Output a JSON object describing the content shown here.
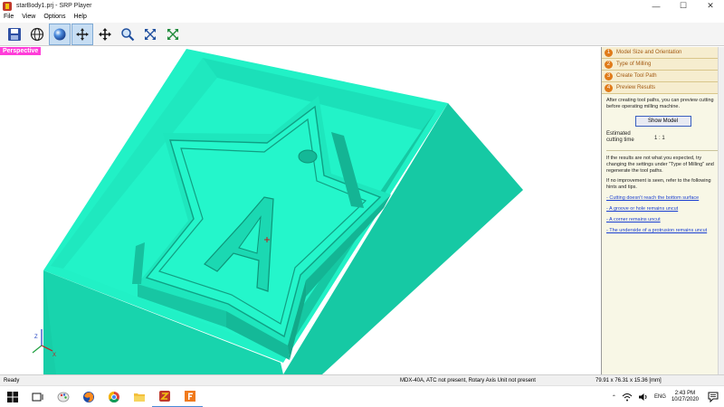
{
  "window": {
    "title": "starBody1.prj - SRP Player",
    "controls": [
      "—",
      "☐",
      "✕"
    ]
  },
  "menu": [
    "File",
    "View",
    "Options",
    "Help"
  ],
  "toolbar": {
    "tools": [
      "save-icon",
      "globe-icon",
      "sphere-icon",
      "move-cursor-icon",
      "pan-icon",
      "zoom-icon",
      "fit-view-icon",
      "fit-selection-icon"
    ],
    "active_tools": [
      "sphere-icon",
      "move-cursor-icon"
    ]
  },
  "viewport": {
    "label": "Perspective",
    "model_color": "#20f0c4",
    "label_color": "#ff3dd9"
  },
  "panel": {
    "steps": [
      {
        "num": "1",
        "label": "Model Size and Orientation"
      },
      {
        "num": "2",
        "label": "Type of Milling"
      },
      {
        "num": "3",
        "label": "Create Tool Path"
      },
      {
        "num": "4",
        "label": "Preview Results"
      }
    ],
    "intro": "After creating tool paths, you can preview cutting before operating milling machine.",
    "show_button": "Show Model",
    "estimated_label": "Estimated cutting time",
    "estimated_value": "1 : 1",
    "results_text": "If the results are not what you expected, try changing the settings under \"Type of Milling\" and regenerate the tool paths.",
    "improve_text": "If no improvement is seen, refer to the following hints and tips.",
    "links": [
      "- Cutting doesn't reach the bottom surface",
      "- A groove or hole remains uncut",
      "- A corner remains uncut",
      "- The underside of a protrusion remains uncut"
    ]
  },
  "status": {
    "ready": "Ready",
    "machine": "MDX-40A, ATC not present, Rotary Axis Unit not present",
    "dims": "79.91 x  76.31 x  15.36 [mm]"
  },
  "taskbar": {
    "apps": [
      "windows-start-icon",
      "task-view-icon",
      "paint-icon",
      "firefox-icon",
      "chrome-icon",
      "file-explorer-icon",
      "srp-player-icon",
      "fusion-icon"
    ],
    "running": [
      "srp-player-icon",
      "fusion-icon"
    ],
    "language": "ENG",
    "time": "2:43 PM",
    "date": "10/27/2020"
  }
}
